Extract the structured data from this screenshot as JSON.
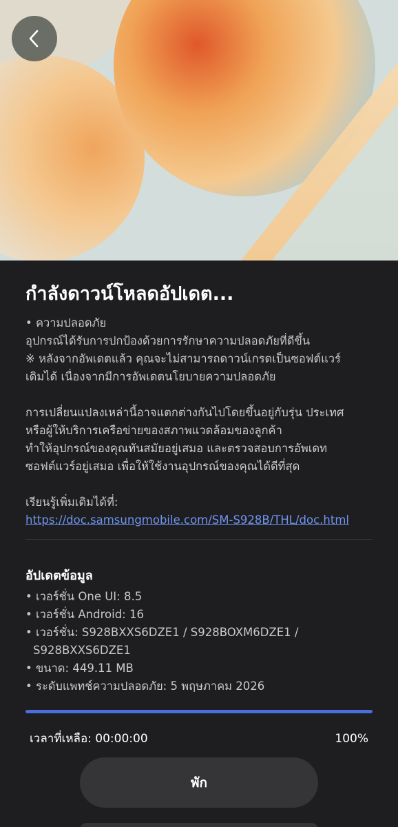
{
  "header": {
    "back_icon": "chevron-left-icon"
  },
  "main": {
    "title": "กำลังดาวน์โหลดอัปเดต...",
    "description_lines": [
      "• ความปลอดภัย",
      "อุปกรณ์ได้รับการปกป้องด้วยการรักษาความปลอดภัยที่ดีขึ้น",
      "※ หลังจากอัพเดตแล้ว คุณจะไม่สามารถดาวน์เกรดเป็นซอฟต์แวร์",
      "เดิมได้ เนื่องจากมีการอัพเดตนโยบายความปลอดภัย"
    ],
    "notice_lines": [
      "การเปลี่ยนแปลงเหล่านี้อาจแตกต่างกันไปโดยขึ้นอยู่กับรุ่น ประเทศ",
      "หรือผู้ให้บริการเครือข่ายของสภาพแวดล้อมของลูกค้า",
      "ทำให้อุปกรณ์ของคุณทันสมัยอยู่เสมอ และตรวจสอบการอัพเดท",
      "ซอฟต์แวร์อยู่เสมอ เพื่อให้ใช้งานอุปกรณ์ของคุณได้ดีที่สุด"
    ],
    "learn_more_label": "เรียนรู้เพิ่มเติมได้ที่:",
    "learn_more_link": "https://doc.samsungmobile.com/SM-S928B/THL/doc.html"
  },
  "update_info": {
    "heading": "อัปเดตข้อมูล",
    "one_ui": "• เวอร์ชั่น One UI: 8.5",
    "android": "• เวอร์ชั่น Android: 16",
    "version_line1": "• เวอร์ชั่น: S928BXXS6DZE1 / S928BOXM6DZE1 /",
    "version_line2": "S928BXXS6DZE1",
    "size": "• ขนาด: 449.11 MB",
    "security_patch": "• ระดับแพทช์ความปลอดภัย: 5 พฤษภาคม 2026"
  },
  "progress": {
    "value": 1.0,
    "time_left": "เวลาที่เหลือ: 00:00:00",
    "percent": "100%"
  },
  "actions": {
    "pause_label": "พัก"
  },
  "colors": {
    "background": "#1e1e21",
    "accent": "#4a6ee0",
    "link": "#6f95f0"
  }
}
